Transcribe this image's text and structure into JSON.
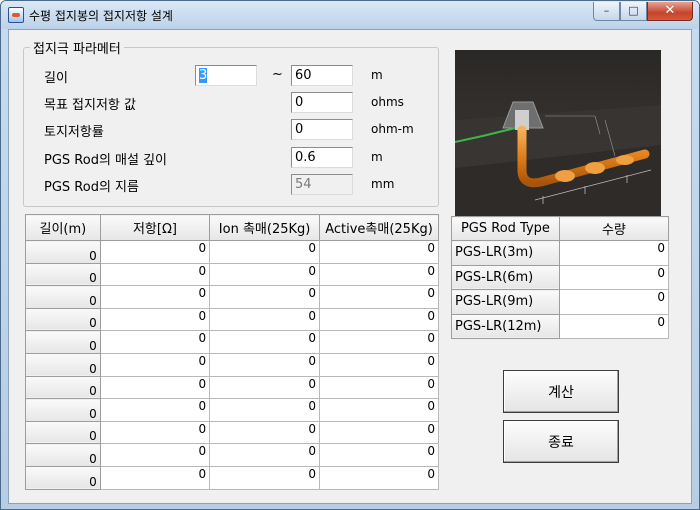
{
  "window": {
    "title": "수평 접지봉의 접지저항 설계"
  },
  "params": {
    "group_title": "접지극 파라메터",
    "length_label": "길이",
    "length_from": "3",
    "tilde": "~",
    "length_to": "60",
    "length_unit": "m",
    "target_label": "목표 접지저항 값",
    "target_value": "0",
    "target_unit": "ohms",
    "resistivity_label": "토지저항률",
    "resistivity_value": "0",
    "resistivity_unit": "ohm-m",
    "depth_label": "PGS Rod의 매설 깊이",
    "depth_value": "0.6",
    "depth_unit": "m",
    "diameter_label": "PGS Rod의 지름",
    "diameter_value": "54",
    "diameter_unit": "mm"
  },
  "result_table": {
    "headers": [
      "길이(m)",
      "저항[Ω]",
      "Ion 촉매(25Kg)",
      "Active촉매(25Kg)"
    ],
    "rows": [
      [
        "0",
        "0",
        "0",
        "0"
      ],
      [
        "0",
        "0",
        "0",
        "0"
      ],
      [
        "0",
        "0",
        "0",
        "0"
      ],
      [
        "0",
        "0",
        "0",
        "0"
      ],
      [
        "0",
        "0",
        "0",
        "0"
      ],
      [
        "0",
        "0",
        "0",
        "0"
      ],
      [
        "0",
        "0",
        "0",
        "0"
      ],
      [
        "0",
        "0",
        "0",
        "0"
      ],
      [
        "0",
        "0",
        "0",
        "0"
      ],
      [
        "0",
        "0",
        "0",
        "0"
      ],
      [
        "0",
        "0",
        "0",
        "0"
      ]
    ]
  },
  "rod_table": {
    "headers": [
      "PGS Rod Type",
      "수량"
    ],
    "rows": [
      [
        "PGS-LR(3m)",
        "0"
      ],
      [
        "PGS-LR(6m)",
        "0"
      ],
      [
        "PGS-LR(9m)",
        "0"
      ],
      [
        "PGS-LR(12m)",
        "0"
      ]
    ]
  },
  "buttons": {
    "calculate": "계산",
    "exit": "종료"
  }
}
